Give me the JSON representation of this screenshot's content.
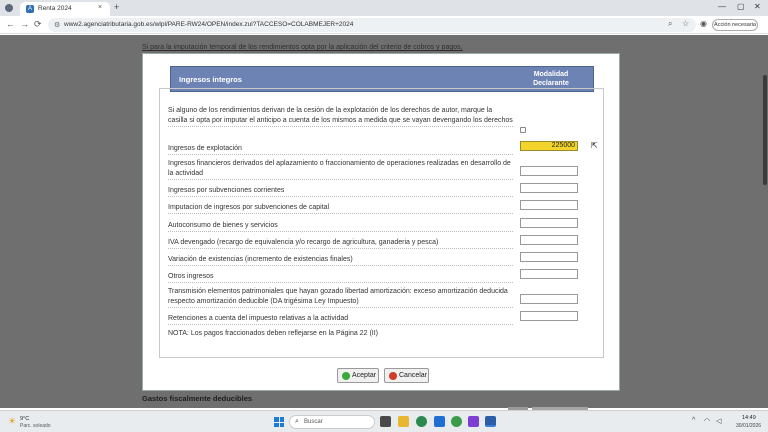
{
  "browser": {
    "tab_title": "Renta 2024",
    "tab_close": "×",
    "new_tab": "+",
    "url": "www2.agenciatributaria.gob.es/wlpl/PARE-RW24/OPEN/index.zul?TACCESO=COLABMEJER+2024",
    "account_button": "Acción necesaria",
    "win_min": "—",
    "win_max": "▢",
    "win_close": "✕",
    "back": "←",
    "forward": "→",
    "reload": "⟳",
    "icons": [
      "zoom-icon",
      "star-icon",
      "profile-icon",
      "menu-icon"
    ]
  },
  "background": {
    "top_text": "Si para la imputación temporal de los rendimientos opta por la aplicación del criterio de cobros y pagos,",
    "footer_text": "Gastos fiscalmente deducibles"
  },
  "modal": {
    "header_title": "Ingresos íntegros",
    "header_col": "Modalidad Declarante",
    "rows": [
      {
        "label": "Si alguno de los rendimientos derivan de la cesión de la explotación de los derechos de autor, marque la casilla si opta por imputar el anticipo a cuenta de los mismos a medida que se vayan devengando los derechos",
        "type": "checkbox",
        "checked": false
      },
      {
        "label": "Ingresos de explotación",
        "type": "input",
        "value": "225000",
        "highlight": true
      },
      {
        "label": "Ingresos financieros derivados del aplazamiento o fraccionamiento de operaciones realizadas en desarrollo de la actividad",
        "type": "input",
        "value": ""
      },
      {
        "label": "Ingresos por subvenciones corrientes",
        "type": "input",
        "value": ""
      },
      {
        "label": "Imputacion de ingresos por subvenciones de capital",
        "type": "input",
        "value": ""
      },
      {
        "label": "Autoconsumo de bienes y servicios",
        "type": "input",
        "value": ""
      },
      {
        "label": "IVA devengado (recargo de equivalencia y/o recargo de agricultura, ganaderia y pesca)",
        "type": "input",
        "value": ""
      },
      {
        "label": "Variación de existencias (incremento de existencias finales)",
        "type": "input",
        "value": ""
      },
      {
        "label": "Otros ingresos",
        "type": "input",
        "value": ""
      },
      {
        "label": "Transmisión elementos patrimoniales que hayan gozado libertad amortización: exceso amortización deducida respecto amortización deducible (DA trigésima Ley Impuesto)",
        "type": "input",
        "value": ""
      },
      {
        "label": "Retenciones a cuenta del impuesto relativas a la actividad",
        "type": "input",
        "value": ""
      }
    ],
    "note": "NOTA: Los pagos fraccionados deben reflejarse en la Página 22 (II)",
    "accept_label": "Aceptar",
    "cancel_label": "Cancelar",
    "colors": {
      "header": "#6d83b3",
      "highlight": "#f2d42b"
    }
  },
  "taskbar": {
    "weather_temp": "9°C",
    "weather_desc": "Parc. soleado",
    "search_placeholder": "Buscar",
    "time": "14:49",
    "date": "30/01/2026"
  }
}
